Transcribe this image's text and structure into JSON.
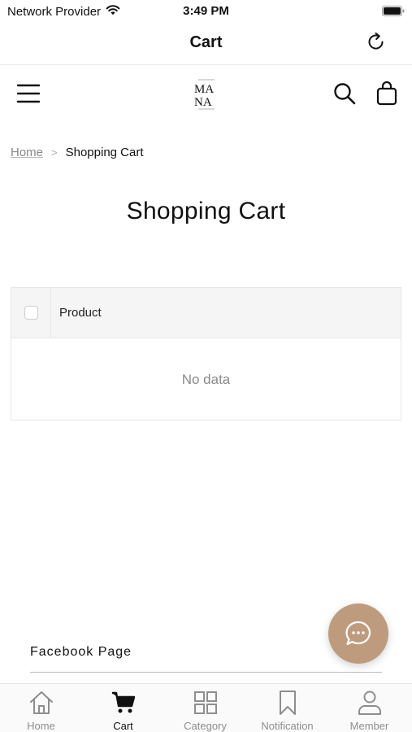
{
  "status_bar": {
    "carrier": "Network Provider",
    "time": "3:49 PM"
  },
  "nav": {
    "title": "Cart"
  },
  "header": {
    "logo_text": "MANA"
  },
  "breadcrumb": {
    "home": "Home",
    "separator": ">",
    "current": "Shopping Cart"
  },
  "page": {
    "title": "Shopping Cart"
  },
  "cart_table": {
    "column_product": "Product",
    "empty_text": "No data"
  },
  "footer": {
    "section_title": "Facebook Page"
  },
  "chat": {
    "icon": "chat-bubble-icon",
    "color": "#bf9b7d"
  },
  "tab_bar": {
    "tabs": [
      {
        "label": "Home",
        "icon": "home-icon",
        "active": false
      },
      {
        "label": "Cart",
        "icon": "cart-icon",
        "active": true
      },
      {
        "label": "Category",
        "icon": "grid-icon",
        "active": false
      },
      {
        "label": "Notification",
        "icon": "bookmark-icon",
        "active": false
      },
      {
        "label": "Member",
        "icon": "person-icon",
        "active": false
      }
    ]
  }
}
